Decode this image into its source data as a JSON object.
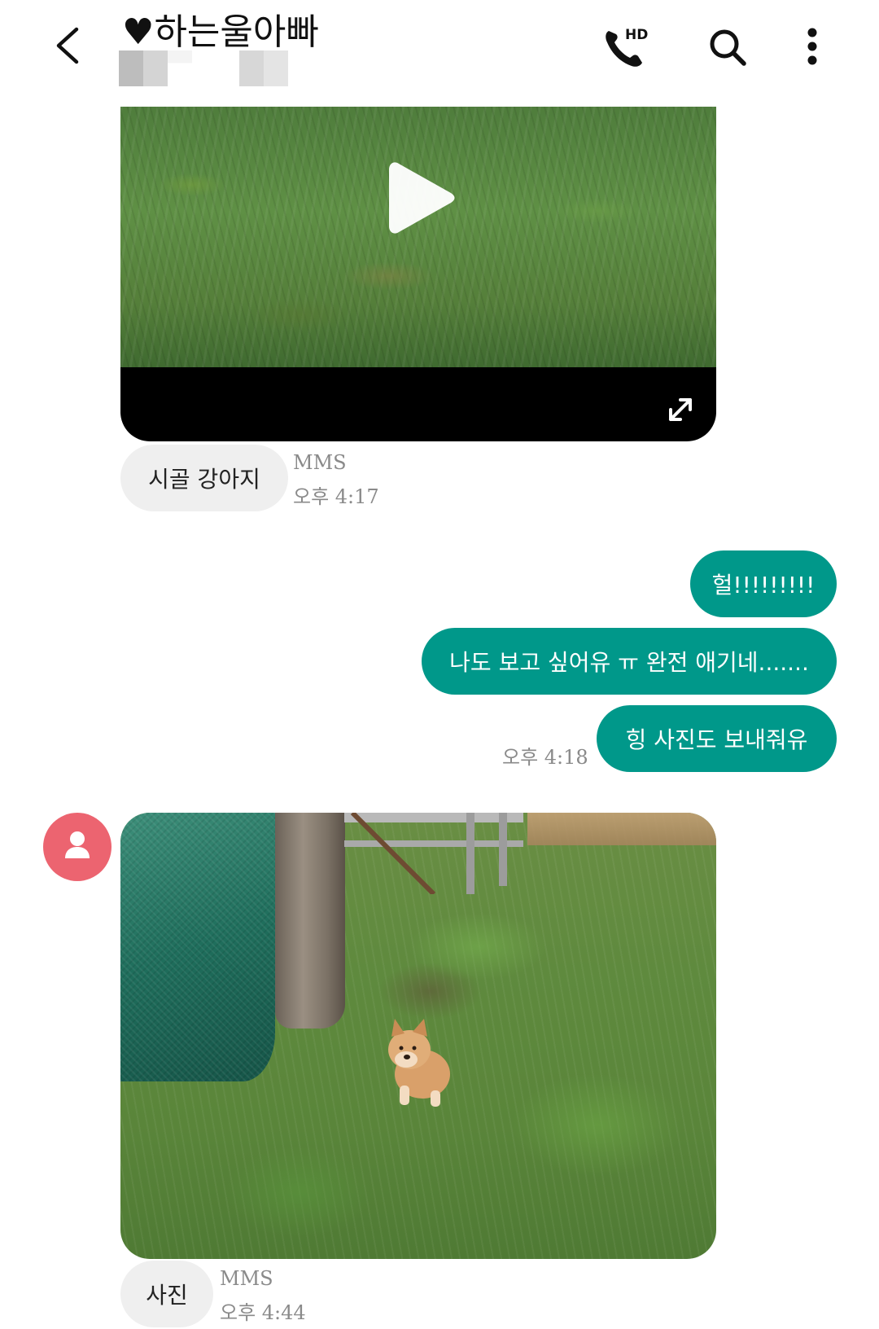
{
  "header": {
    "title": "♥하는울아빠",
    "icons": {
      "back": "back-arrow-icon",
      "call": "hd-voice-call-icon",
      "call_badge": "HD",
      "search": "search-icon",
      "more": "more-vertical-icon"
    }
  },
  "messages": {
    "video_message": {
      "play_icon": "play-icon",
      "expand_icon": "expand-icon"
    },
    "incoming_1": {
      "text": "시골 강아지",
      "type_label": "MMS",
      "time": "오후 4:17"
    },
    "outgoing": [
      {
        "text": "헐!!!!!!!!!"
      },
      {
        "text": "나도 보고 싶어유 ㅠ 완전 애기네......."
      },
      {
        "text": "힝 사진도 보내줘유"
      }
    ],
    "outgoing_time": "오후 4:18",
    "photo_message": {
      "avatar_icon": "contact-avatar-icon"
    },
    "incoming_2": {
      "text": "사진",
      "type_label": "MMS",
      "time": "오후 4:44"
    }
  },
  "colors": {
    "outgoing_bubble": "#00988a",
    "incoming_bubble": "#efefef",
    "avatar": "#ec6470"
  }
}
